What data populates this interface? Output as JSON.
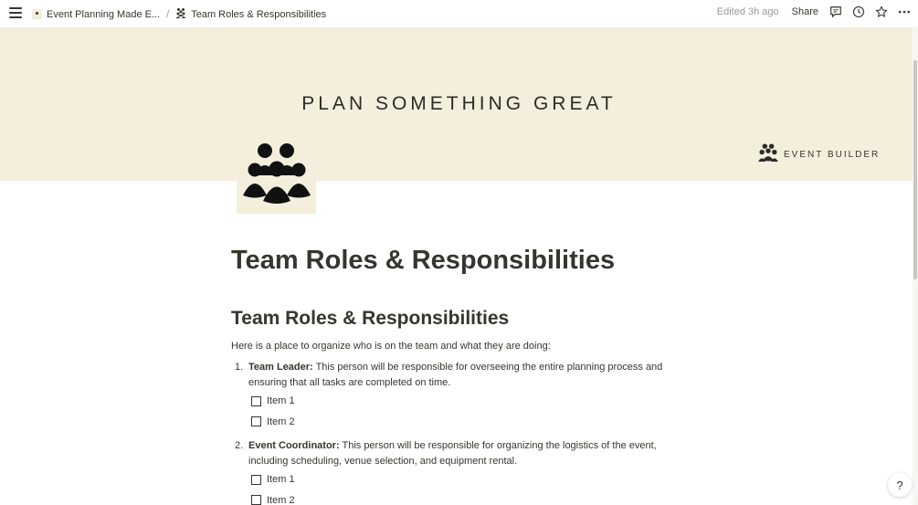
{
  "topbar": {
    "breadcrumbs": [
      {
        "label": "Event Planning Made E...",
        "icon": "event-page-icon"
      },
      {
        "label": "Team Roles & Responsibilities",
        "icon": "team-icon"
      }
    ],
    "separator": "/",
    "edited": "Edited 3h ago",
    "share_label": "Share",
    "icons": [
      "menu-icon",
      "comment-icon",
      "clock-icon",
      "star-icon",
      "more-icon"
    ]
  },
  "cover": {
    "title": "PLAN SOMETHING GREAT",
    "brand_text": "EVENT BUILDER",
    "background": "#f4efdd"
  },
  "page": {
    "title": "Team Roles & Responsibilities",
    "heading": "Team Roles & Responsibilities",
    "intro": "Here is a place to organize who is on the team and what they are doing:",
    "roles": [
      {
        "number": "1.",
        "name": "Team Leader:",
        "description": " This person will be responsible for overseeing the entire planning process and ensuring that all tasks are completed on time.",
        "todos": [
          {
            "label": "Item 1",
            "checked": false
          },
          {
            "label": "Item 2",
            "checked": false
          }
        ]
      },
      {
        "number": "2.",
        "name": "Event Coordinator:",
        "description": " This person will be responsible for organizing the logistics of the event, including scheduling, venue selection, and equipment rental.",
        "todos": [
          {
            "label": "Item 1",
            "checked": false
          },
          {
            "label": "Item 2",
            "checked": false
          }
        ]
      }
    ]
  },
  "help_label": "?"
}
